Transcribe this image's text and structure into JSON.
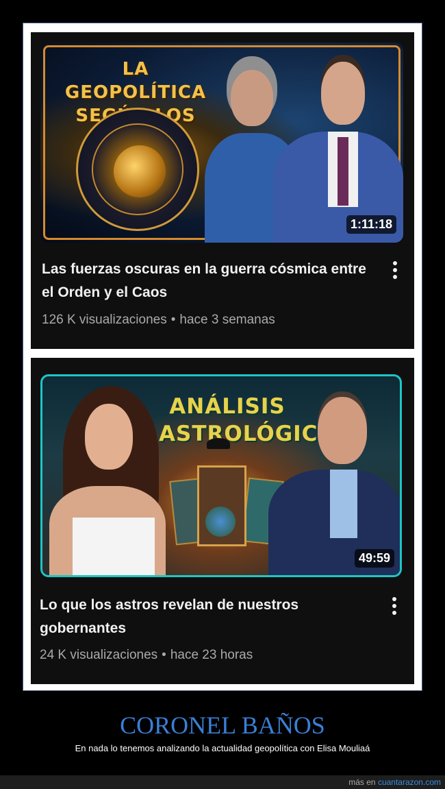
{
  "videos": [
    {
      "thumbnail_text": "LA GEOPOLÍTICA SEGÚN LOS ASTROS",
      "duration": "1:11:18",
      "title": "Las fuerzas oscuras en la guerra cósmica entre el Orden y el Caos",
      "views": "126 K visualizaciones",
      "age": "hace 3 semanas"
    },
    {
      "thumbnail_text": "ANÁLISIS ASTROLÓGICO",
      "duration": "49:59",
      "title": "Lo que los astros revelan de nuestros gobernantes",
      "views": "24 K visualizaciones",
      "age": "hace 23 horas"
    }
  ],
  "separator": "•",
  "caption": {
    "title": "CORONEL BAÑOS",
    "subtitle": "En nada lo tenemos analizando la actualidad geopolítica con Elisa Mouliaá"
  },
  "footer": {
    "prefix": "más en",
    "site": "cuantarazon.com"
  },
  "icons": [
    "more-vert-icon"
  ]
}
